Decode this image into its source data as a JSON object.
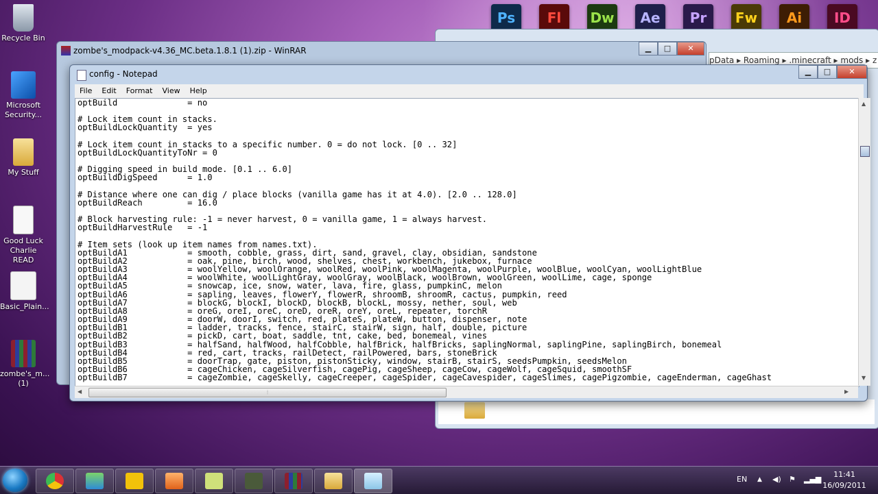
{
  "desktop_icons": [
    {
      "label": "Recycle Bin"
    },
    {
      "label": "Microsoft Security..."
    },
    {
      "label": "My Stuff"
    },
    {
      "label": "Good Luck Charlie READ"
    },
    {
      "label": "Basic_Plain..."
    },
    {
      "label": "zombe's_m... (1)"
    }
  ],
  "top_apps": [
    "Ps",
    "Fl",
    "Dw",
    "Ae",
    "Pr",
    "Fw",
    "Ai",
    "ID"
  ],
  "explorer_path": "pData  ▸  Roaming  ▸  .minecraft  ▸  mods  ▸  z",
  "winrar": {
    "title": "zombe's_modpack-v4.36_MC.beta.1.8.1 (1).zip - WinRAR"
  },
  "notepad": {
    "title": "config - Notepad",
    "menu": [
      "File",
      "Edit",
      "Format",
      "View",
      "Help"
    ],
    "content": "optBuild              = no\n\n# Lock item count in stacks.\noptBuildLockQuantity  = yes\n\n# Lock item count in stacks to a specific number. 0 = do not lock. [0 .. 32]\noptBuildLockQuantityToNr = 0\n\n# Digging speed in build mode. [0.1 .. 6.0]\noptBuildDigSpeed      = 1.0\n\n# Distance where one can dig / place blocks (vanilla game has it at 4.0). [2.0 .. 128.0]\noptBuildReach         = 16.0\n\n# Block harvesting rule: -1 = never harvest, 0 = vanilla game, 1 = always harvest.\noptBuildHarvestRule   = -1\n\n# Item sets (look up item names from names.txt).\noptBuildA1            = smooth, cobble, grass, dirt, sand, gravel, clay, obsidian, sandstone\noptBuildA2            = oak, pine, birch, wood, shelves, chest, workbench, jukebox, furnace\noptBuildA3            = woolYellow, woolOrange, woolRed, woolPink, woolMagenta, woolPurple, woolBlue, woolCyan, woolLightBlue\noptBuildA4            = woolWhite, woolLightGray, woolGray, woolBlack, woolBrown, woolGreen, woolLime, cage, sponge\noptBuildA5            = snowcap, ice, snow, water, lava, fire, glass, pumpkinC, melon\noptBuildA6            = sapling, leaves, flowerY, flowerR, shroomB, shroomR, cactus, pumpkin, reed\noptBuildA7            = blockG, blockI, blockD, blockB, blockL, mossy, nether, soul, web\noptBuildA8            = oreG, oreI, oreC, oreD, oreR, oreY, oreL, repeater, torchR\noptBuildA9            = doorW, doorI, switch, red, plateS, plateW, button, dispenser, note\noptBuildB1            = ladder, tracks, fence, stairC, stairW, sign, half, double, picture\noptBuildB2            = pickD, cart, boat, saddle, tnt, cake, bed, bonemeal, vines\noptBuildB3            = halfSand, halfWood, halfCobble, halfBrick, halfBricks, saplingNormal, saplingPine, saplingBirch, bonemeal\noptBuildB4            = red, cart, tracks, railDetect, railPowered, bars, stoneBrick\noptBuildB5            = doorTrap, gate, piston, pistonSticky, window, stairB, stairS, seedsPumpkin, seedsMelon\noptBuildB6            = cageChicken, cageSilverfish, cagePig, cageSheep, cageCow, cageWolf, cageSquid, smoothSF\noptBuildB7            = cageZombie, cageSkelly, cageCreeper, cageSpider, cageCavespider, cageSlimes, cagePigzombie, cageEnderman, cageGhast"
  },
  "tray": {
    "lang": "EN",
    "time": "11:41",
    "date": "16/09/2011"
  },
  "colors": {
    "desktop": "#6b2e85",
    "taskbar": "#261a36",
    "notepad_frame": "#c4d5ea"
  }
}
